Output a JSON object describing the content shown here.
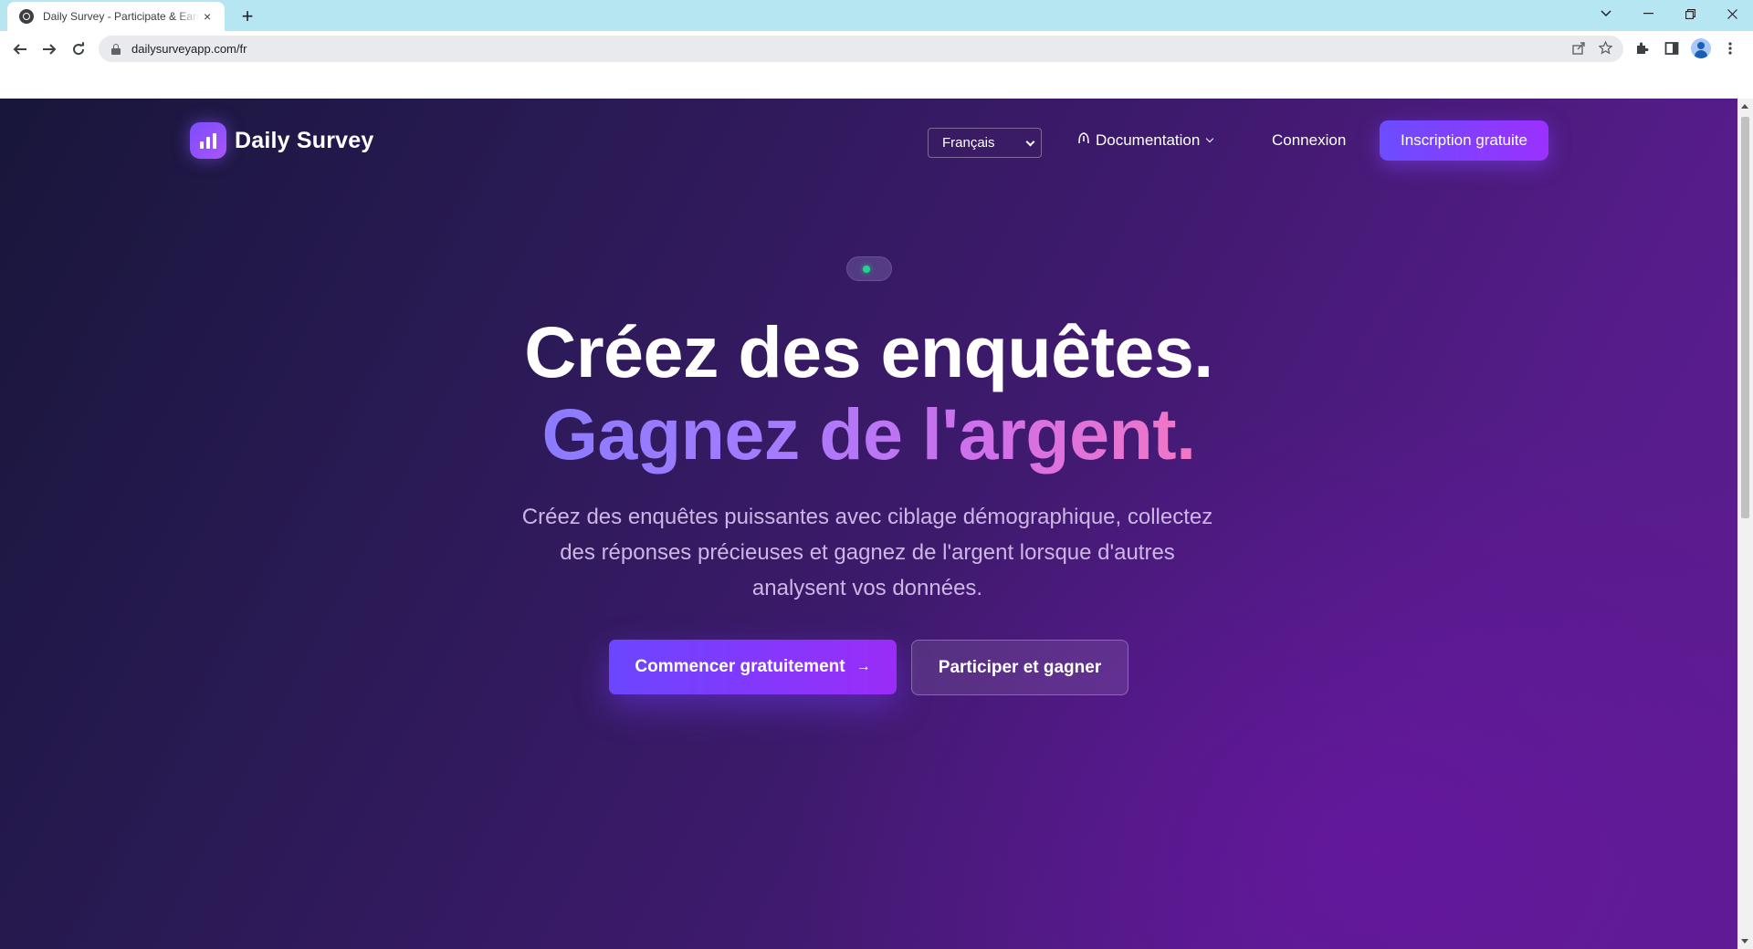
{
  "browser": {
    "tab_title": "Daily Survey - Participate & Earn",
    "tab_close": "×",
    "new_tab": "+",
    "url": "dailysurveyapp.com/fr",
    "icons": [
      "back-icon",
      "forward-icon",
      "reload-icon",
      "lock-icon",
      "share-icon",
      "bookmark-star-icon",
      "extensions-icon",
      "side-panel-icon",
      "profile-avatar-icon",
      "kebab-menu-icon",
      "tab-search-icon",
      "minimize-icon",
      "restore-icon",
      "close-icon"
    ]
  },
  "site": {
    "brand_name": "Daily Survey",
    "language_selected": "Français",
    "doc_link": "Documentation",
    "login": "Connexion",
    "signup": "Inscription gratuite"
  },
  "hero": {
    "title_line1": "Créez des enquêtes.",
    "title_line2": "Gagnez de l'argent.",
    "subtitle": "Créez des enquêtes puissantes avec ciblage démographique, collectez des réponses précieuses et gagnez de l'argent lorsque d'autres analysent vos données.",
    "cta_primary": "Commencer gratuitement",
    "cta_primary_arrow": "→",
    "cta_secondary": "Participer et gagner"
  },
  "colors": {
    "accent": "#7c4dff",
    "accent_end": "#9b30ff",
    "badge_dot": "#22d38a",
    "gradient_text_start": "#8b7bff",
    "gradient_text_end": "#f277c4"
  }
}
